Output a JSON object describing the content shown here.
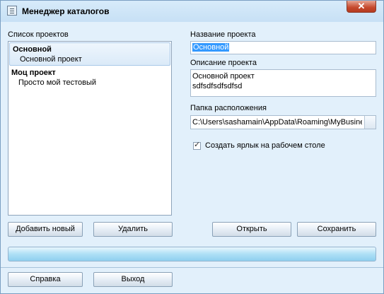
{
  "window": {
    "title": "Менеджер каталогов",
    "close_label": "✕"
  },
  "projects": {
    "header": "Список проектов",
    "items": [
      {
        "name": "Основной",
        "description": "Основной проект"
      },
      {
        "name": "Моц проект",
        "description": "Просто мой тестовый"
      }
    ]
  },
  "form": {
    "name_label": "Название проекта",
    "name_value": "Основной",
    "desc_label": "Описание проекта",
    "desc_line1": "Основной проект",
    "desc_line2": "sdfsdfsdfsdfsd",
    "folder_label": "Папка расположения",
    "folder_value": "C:\\Users\\sashamain\\AppData\\Roaming\\MyBusiness",
    "shortcut_label": "Создать ярлык на рабочем столе",
    "shortcut_checked": true
  },
  "buttons": {
    "add": "Добавить новый",
    "delete": "Удалить",
    "open": "Открыть",
    "save": "Сохранить",
    "help": "Справка",
    "exit": "Выход"
  },
  "progress": {
    "value": 1.0
  },
  "colors": {
    "accent": "#3399ff",
    "progress_fill": "#aee0f6"
  }
}
